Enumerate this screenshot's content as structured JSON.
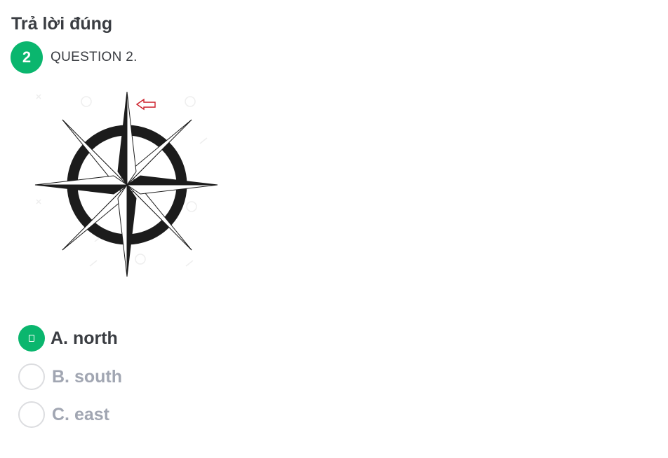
{
  "header": {
    "title": "Trả lời đúng"
  },
  "question": {
    "number": "2",
    "label": "QUESTION 2.",
    "image": {
      "icon": "compass-rose-icon",
      "pointer": "arrow-left-outline-icon",
      "accent_color": "#cc1f2a"
    }
  },
  "answers": {
    "accent_color": "#0ab66e",
    "options": [
      {
        "label": "A. north",
        "selected": true
      },
      {
        "label": "B. south",
        "selected": false
      },
      {
        "label": "C. east",
        "selected": false
      }
    ]
  }
}
